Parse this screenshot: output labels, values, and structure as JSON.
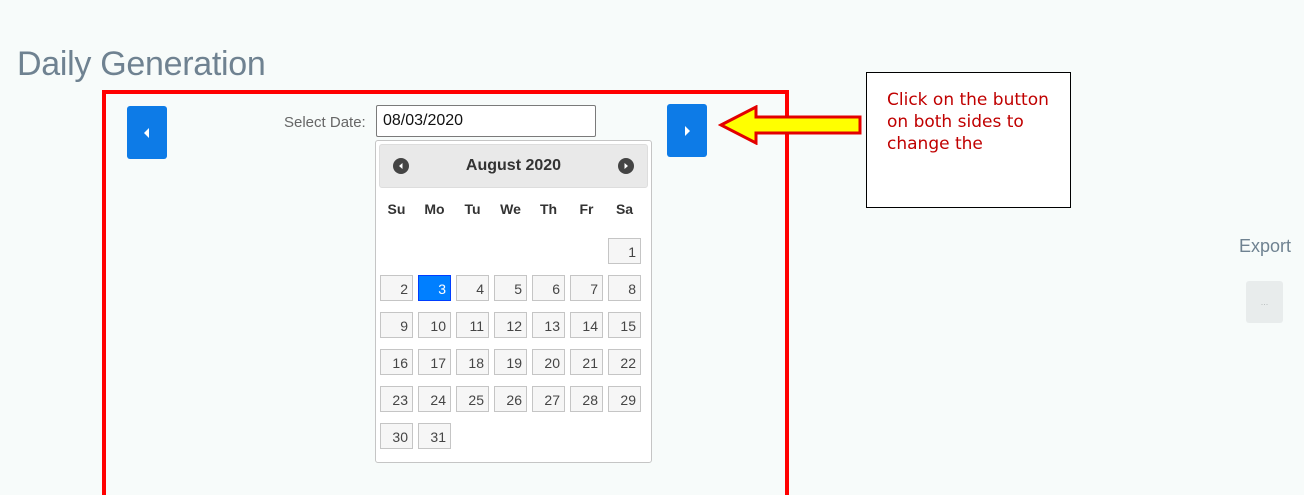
{
  "page": {
    "title": "Daily Generation"
  },
  "date_select": {
    "label": "Select Date:",
    "value": "08/03/2020"
  },
  "datepicker": {
    "month_title": "August 2020",
    "weekdays": [
      "Su",
      "Mo",
      "Tu",
      "We",
      "Th",
      "Fr",
      "Sa"
    ],
    "first_weekday_index": 6,
    "days_in_month": 31,
    "selected_day": 3
  },
  "callout": {
    "text": "Click on the button on both sides to change the"
  },
  "export": {
    "label": "Export",
    "button_text": "..."
  },
  "colors": {
    "accent": "#0d7be7",
    "highlight_border": "#ff0000",
    "callout_text": "#c00000",
    "arrow_fill": "#ffff00",
    "selected_day": "#007fff"
  },
  "icons": {
    "prev_button": "caret-left-icon",
    "next_button": "caret-right-icon",
    "dp_prev": "circle-arrow-left-icon",
    "dp_next": "circle-arrow-right-icon",
    "pointer": "yellow-arrow-left-icon"
  }
}
